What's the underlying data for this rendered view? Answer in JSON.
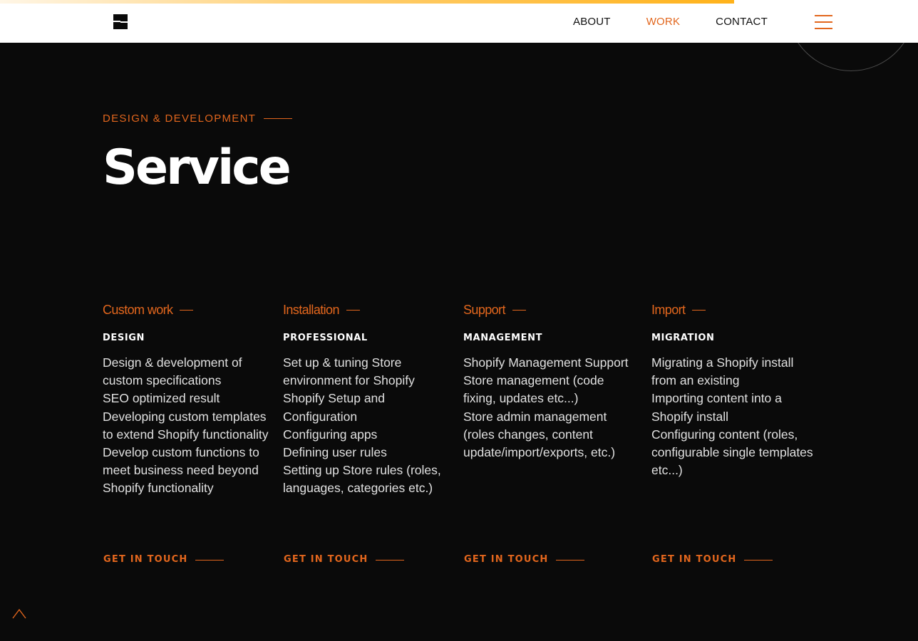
{
  "header": {
    "nav": {
      "about": "ABOUT",
      "work": "WORK",
      "contact": "CONTACT"
    },
    "menu_icon": "hamburger-icon"
  },
  "hero": {
    "eyebrow": "DESIGN & DEVELOPMENT",
    "title": "Service"
  },
  "services": [
    {
      "title": "Custom work",
      "subtitle": "DESIGN",
      "items": [
        "Design & development of custom specifications",
        "SEO optimized result",
        "Developing custom templates to extend Shopify functionality",
        "Develop custom functions to meet business need beyond Shopify functionality"
      ],
      "cta": "GET IN TOUCH"
    },
    {
      "title": "Installation",
      "subtitle": "PROFESSIONAL",
      "items": [
        "Set up & tuning Store environment for Shopify",
        "Shopify Setup and Configuration",
        "Configuring apps",
        "Defining user rules",
        "Setting up Store rules (roles, languages, categories etc.)"
      ],
      "cta": "GET IN TOUCH"
    },
    {
      "title": "Support",
      "subtitle": "MANAGEMENT",
      "items": [
        "Shopify Management Support",
        "Store management (code fixing, updates etc...)",
        "Store admin management (roles changes, content update/import/exports, etc.)"
      ],
      "cta": "GET IN TOUCH"
    },
    {
      "title": "Import",
      "subtitle": "MIGRATION",
      "items": [
        "Migrating a Shopify install from an existing",
        "Importing content into a Shopify install",
        "Configuring content (roles, configurable single templates etc...)"
      ],
      "cta": "GET IN TOUCH"
    }
  ],
  "back_to_top_icon": "chevron-up-icon",
  "colors": {
    "accent": "#e2661d",
    "background": "#0a0a0a",
    "header_bg": "#ffffff",
    "progress": "#ffb21a"
  },
  "scroll_progress": 0.8
}
